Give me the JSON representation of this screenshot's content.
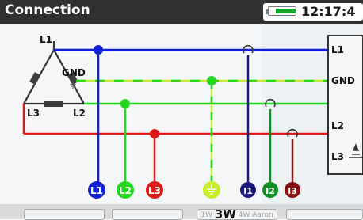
{
  "header": {
    "title": "Connection",
    "time": "12:17:4"
  },
  "diagram": {
    "source": {
      "label_l1": "L1",
      "label_gnd": "GND",
      "label_l3": "L3",
      "label_l2": "L2"
    },
    "instrument": {
      "label_l1": "L1",
      "label_gnd": "GND",
      "label_l2": "L2",
      "label_l3": "L3"
    },
    "terminals": [
      "L1",
      "L2",
      "L3"
    ],
    "current_clamps": [
      "I1",
      "I2",
      "I3"
    ],
    "colors": {
      "l1": "#1020d8",
      "l2": "#22d81e",
      "l3": "#e01818",
      "gnd": "#c8ec2a",
      "gnd_dash": "#22d81e",
      "i1": "#1a1a80",
      "i2": "#0f8f1f",
      "i3": "#8a1010"
    }
  },
  "footer": {
    "mode_options": [
      "1W",
      "3W",
      "4W Aaron"
    ],
    "mode_selected": "3W"
  }
}
